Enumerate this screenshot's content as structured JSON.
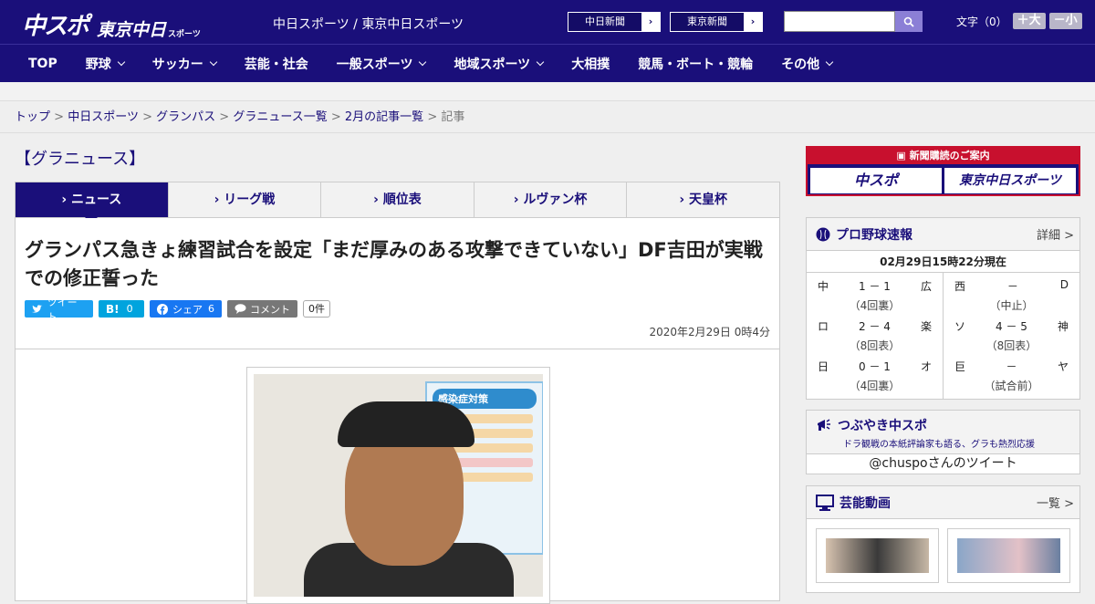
{
  "header": {
    "logo_main": "中スポ",
    "logo_sub": "東京中日",
    "logo_small": "スポーツ",
    "site_name": "中日スポーツ / 東京中日スポーツ",
    "ext_links": [
      "中日新聞",
      "東京新聞"
    ],
    "search_placeholder": "",
    "fontsize_label": "文字（0）",
    "font_bigger": "＋大",
    "font_smaller": "－小"
  },
  "nav": {
    "items": [
      {
        "label": "TOP",
        "dropdown": false
      },
      {
        "label": "野球",
        "dropdown": true
      },
      {
        "label": "サッカー",
        "dropdown": true
      },
      {
        "label": "芸能・社会",
        "dropdown": false
      },
      {
        "label": "一般スポーツ",
        "dropdown": true
      },
      {
        "label": "地域スポーツ",
        "dropdown": true
      },
      {
        "label": "大相撲",
        "dropdown": false
      },
      {
        "label": "競馬・ボート・競輪",
        "dropdown": false
      },
      {
        "label": "その他",
        "dropdown": true
      }
    ]
  },
  "breadcrumb": {
    "items": [
      "トップ",
      "中日スポーツ",
      "グランパス",
      "グラニュース一覧",
      "2月の記事一覧"
    ],
    "current": "記事",
    "separator": ">"
  },
  "main": {
    "category_title": "【グラニュース】",
    "tabs": [
      "ニュース",
      "リーグ戦",
      "順位表",
      "ルヴァン杯",
      "天皇杯"
    ],
    "active_tab": 0,
    "headline": "グランパス急きょ練習試合を設定「まだ厚みのある攻撃できていない」DF吉田が実戦での修正誓った",
    "share": {
      "tweet": "ツイート",
      "hatena_label": "B!",
      "hatena_count": "0",
      "facebook": "シェア",
      "facebook_count": "6",
      "comment": "コメント",
      "comment_count": "0件"
    },
    "date": "2020年2月29日 0時4分",
    "photo_poster_title": "感染症対策"
  },
  "sidebar": {
    "subscribe": {
      "header": "新聞購読のご案内",
      "left": "中スポ",
      "right": "東京中日スポーツ"
    },
    "baseball": {
      "title": "プロ野球速報",
      "more": "詳細 >",
      "updated": "02月29日15時22分現在",
      "games_left": [
        {
          "home": "中",
          "score": "1 － 1",
          "away": "広",
          "status": "（4回裏）"
        },
        {
          "home": "ロ",
          "score": "2 － 4",
          "away": "楽",
          "status": "（8回表）"
        },
        {
          "home": "日",
          "score": "0 － 1",
          "away": "オ",
          "status": "（4回裏）"
        }
      ],
      "games_right": [
        {
          "home": "西",
          "score": "－",
          "away": "D",
          "status": "（中止）"
        },
        {
          "home": "ソ",
          "score": "4 － 5",
          "away": "神",
          "status": "（8回表）"
        },
        {
          "home": "巨",
          "score": "－",
          "away": "ヤ",
          "status": "（試合前）"
        }
      ]
    },
    "tweets": {
      "title": "つぶやき中スポ",
      "desc": "ドラ観戦の本紙評論家も語る、グラも熱烈応援",
      "account": "@chuspoさんのツイート"
    },
    "videos": {
      "title": "芸能動画",
      "more": "一覧 >"
    }
  },
  "colors": {
    "brand": "#1a0f7a",
    "accent_red": "#c8102e",
    "twitter": "#1da1f2",
    "hatena": "#00a4de",
    "facebook": "#1877f2"
  }
}
